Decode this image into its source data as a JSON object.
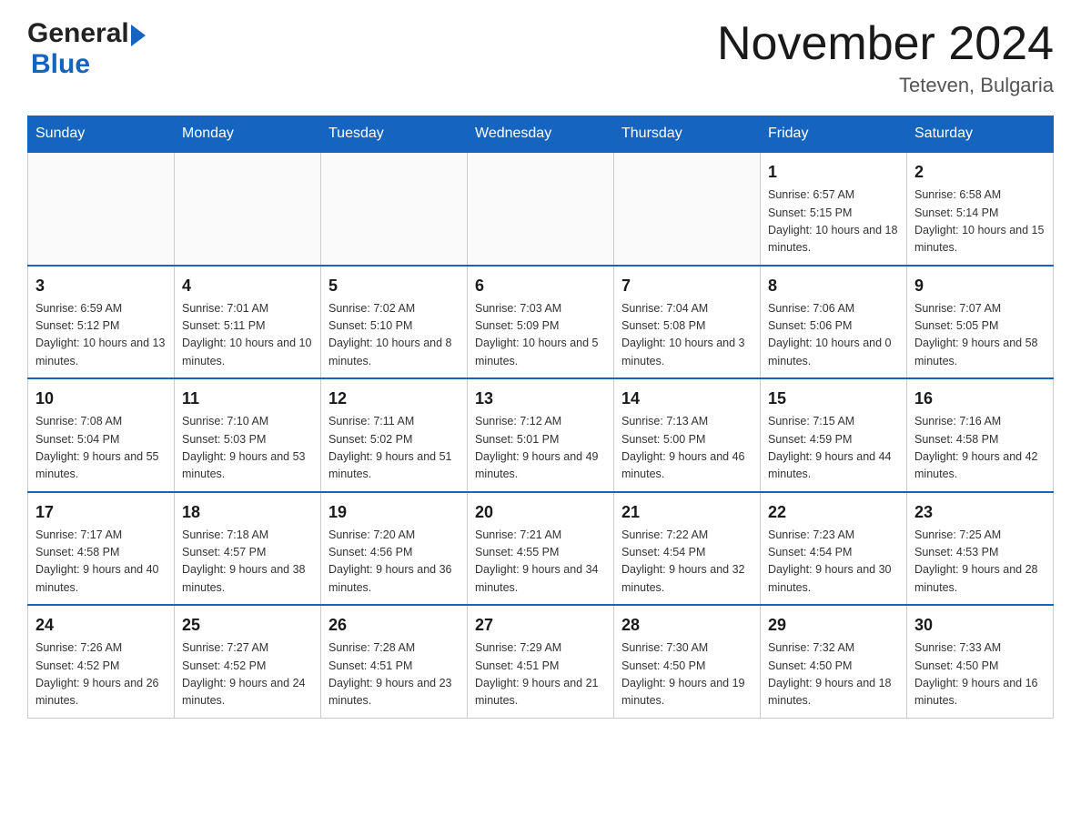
{
  "header": {
    "logo_general": "General",
    "logo_blue": "Blue",
    "month_title": "November 2024",
    "location": "Teteven, Bulgaria"
  },
  "weekdays": [
    "Sunday",
    "Monday",
    "Tuesday",
    "Wednesday",
    "Thursday",
    "Friday",
    "Saturday"
  ],
  "weeks": [
    [
      {
        "day": "",
        "sunrise": "",
        "sunset": "",
        "daylight": ""
      },
      {
        "day": "",
        "sunrise": "",
        "sunset": "",
        "daylight": ""
      },
      {
        "day": "",
        "sunrise": "",
        "sunset": "",
        "daylight": ""
      },
      {
        "day": "",
        "sunrise": "",
        "sunset": "",
        "daylight": ""
      },
      {
        "day": "",
        "sunrise": "",
        "sunset": "",
        "daylight": ""
      },
      {
        "day": "1",
        "sunrise": "Sunrise: 6:57 AM",
        "sunset": "Sunset: 5:15 PM",
        "daylight": "Daylight: 10 hours and 18 minutes."
      },
      {
        "day": "2",
        "sunrise": "Sunrise: 6:58 AM",
        "sunset": "Sunset: 5:14 PM",
        "daylight": "Daylight: 10 hours and 15 minutes."
      }
    ],
    [
      {
        "day": "3",
        "sunrise": "Sunrise: 6:59 AM",
        "sunset": "Sunset: 5:12 PM",
        "daylight": "Daylight: 10 hours and 13 minutes."
      },
      {
        "day": "4",
        "sunrise": "Sunrise: 7:01 AM",
        "sunset": "Sunset: 5:11 PM",
        "daylight": "Daylight: 10 hours and 10 minutes."
      },
      {
        "day": "5",
        "sunrise": "Sunrise: 7:02 AM",
        "sunset": "Sunset: 5:10 PM",
        "daylight": "Daylight: 10 hours and 8 minutes."
      },
      {
        "day": "6",
        "sunrise": "Sunrise: 7:03 AM",
        "sunset": "Sunset: 5:09 PM",
        "daylight": "Daylight: 10 hours and 5 minutes."
      },
      {
        "day": "7",
        "sunrise": "Sunrise: 7:04 AM",
        "sunset": "Sunset: 5:08 PM",
        "daylight": "Daylight: 10 hours and 3 minutes."
      },
      {
        "day": "8",
        "sunrise": "Sunrise: 7:06 AM",
        "sunset": "Sunset: 5:06 PM",
        "daylight": "Daylight: 10 hours and 0 minutes."
      },
      {
        "day": "9",
        "sunrise": "Sunrise: 7:07 AM",
        "sunset": "Sunset: 5:05 PM",
        "daylight": "Daylight: 9 hours and 58 minutes."
      }
    ],
    [
      {
        "day": "10",
        "sunrise": "Sunrise: 7:08 AM",
        "sunset": "Sunset: 5:04 PM",
        "daylight": "Daylight: 9 hours and 55 minutes."
      },
      {
        "day": "11",
        "sunrise": "Sunrise: 7:10 AM",
        "sunset": "Sunset: 5:03 PM",
        "daylight": "Daylight: 9 hours and 53 minutes."
      },
      {
        "day": "12",
        "sunrise": "Sunrise: 7:11 AM",
        "sunset": "Sunset: 5:02 PM",
        "daylight": "Daylight: 9 hours and 51 minutes."
      },
      {
        "day": "13",
        "sunrise": "Sunrise: 7:12 AM",
        "sunset": "Sunset: 5:01 PM",
        "daylight": "Daylight: 9 hours and 49 minutes."
      },
      {
        "day": "14",
        "sunrise": "Sunrise: 7:13 AM",
        "sunset": "Sunset: 5:00 PM",
        "daylight": "Daylight: 9 hours and 46 minutes."
      },
      {
        "day": "15",
        "sunrise": "Sunrise: 7:15 AM",
        "sunset": "Sunset: 4:59 PM",
        "daylight": "Daylight: 9 hours and 44 minutes."
      },
      {
        "day": "16",
        "sunrise": "Sunrise: 7:16 AM",
        "sunset": "Sunset: 4:58 PM",
        "daylight": "Daylight: 9 hours and 42 minutes."
      }
    ],
    [
      {
        "day": "17",
        "sunrise": "Sunrise: 7:17 AM",
        "sunset": "Sunset: 4:58 PM",
        "daylight": "Daylight: 9 hours and 40 minutes."
      },
      {
        "day": "18",
        "sunrise": "Sunrise: 7:18 AM",
        "sunset": "Sunset: 4:57 PM",
        "daylight": "Daylight: 9 hours and 38 minutes."
      },
      {
        "day": "19",
        "sunrise": "Sunrise: 7:20 AM",
        "sunset": "Sunset: 4:56 PM",
        "daylight": "Daylight: 9 hours and 36 minutes."
      },
      {
        "day": "20",
        "sunrise": "Sunrise: 7:21 AM",
        "sunset": "Sunset: 4:55 PM",
        "daylight": "Daylight: 9 hours and 34 minutes."
      },
      {
        "day": "21",
        "sunrise": "Sunrise: 7:22 AM",
        "sunset": "Sunset: 4:54 PM",
        "daylight": "Daylight: 9 hours and 32 minutes."
      },
      {
        "day": "22",
        "sunrise": "Sunrise: 7:23 AM",
        "sunset": "Sunset: 4:54 PM",
        "daylight": "Daylight: 9 hours and 30 minutes."
      },
      {
        "day": "23",
        "sunrise": "Sunrise: 7:25 AM",
        "sunset": "Sunset: 4:53 PM",
        "daylight": "Daylight: 9 hours and 28 minutes."
      }
    ],
    [
      {
        "day": "24",
        "sunrise": "Sunrise: 7:26 AM",
        "sunset": "Sunset: 4:52 PM",
        "daylight": "Daylight: 9 hours and 26 minutes."
      },
      {
        "day": "25",
        "sunrise": "Sunrise: 7:27 AM",
        "sunset": "Sunset: 4:52 PM",
        "daylight": "Daylight: 9 hours and 24 minutes."
      },
      {
        "day": "26",
        "sunrise": "Sunrise: 7:28 AM",
        "sunset": "Sunset: 4:51 PM",
        "daylight": "Daylight: 9 hours and 23 minutes."
      },
      {
        "day": "27",
        "sunrise": "Sunrise: 7:29 AM",
        "sunset": "Sunset: 4:51 PM",
        "daylight": "Daylight: 9 hours and 21 minutes."
      },
      {
        "day": "28",
        "sunrise": "Sunrise: 7:30 AM",
        "sunset": "Sunset: 4:50 PM",
        "daylight": "Daylight: 9 hours and 19 minutes."
      },
      {
        "day": "29",
        "sunrise": "Sunrise: 7:32 AM",
        "sunset": "Sunset: 4:50 PM",
        "daylight": "Daylight: 9 hours and 18 minutes."
      },
      {
        "day": "30",
        "sunrise": "Sunrise: 7:33 AM",
        "sunset": "Sunset: 4:50 PM",
        "daylight": "Daylight: 9 hours and 16 minutes."
      }
    ]
  ]
}
